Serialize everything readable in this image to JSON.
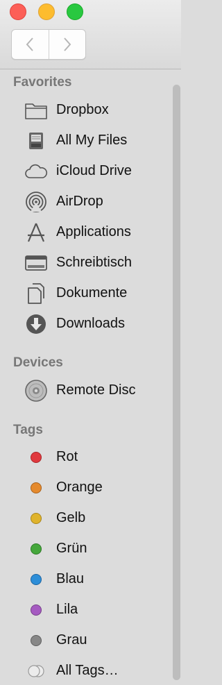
{
  "window": {
    "traffic_lights": {
      "close": "#fc5f57",
      "minimize": "#fdbc2e",
      "zoom": "#29c840"
    }
  },
  "nav": {
    "back_icon": "chevron-left-icon",
    "forward_icon": "chevron-right-icon"
  },
  "sidebar": {
    "favorites": {
      "header": "Favorites",
      "items": [
        {
          "label": "Dropbox",
          "icon": "folder-icon"
        },
        {
          "label": "All My Files",
          "icon": "all-files-icon"
        },
        {
          "label": "iCloud Drive",
          "icon": "cloud-icon"
        },
        {
          "label": "AirDrop",
          "icon": "airdrop-icon"
        },
        {
          "label": "Applications",
          "icon": "applications-icon"
        },
        {
          "label": "Schreibtisch",
          "icon": "desktop-icon"
        },
        {
          "label": "Dokumente",
          "icon": "document-icon"
        },
        {
          "label": "Downloads",
          "icon": "download-icon"
        }
      ]
    },
    "devices": {
      "header": "Devices",
      "items": [
        {
          "label": "Remote Disc",
          "icon": "disc-icon"
        }
      ]
    },
    "tags": {
      "header": "Tags",
      "items": [
        {
          "label": "Rot",
          "color": "#e0393e"
        },
        {
          "label": "Orange",
          "color": "#e58a2d"
        },
        {
          "label": "Gelb",
          "color": "#dfb32c"
        },
        {
          "label": "Grün",
          "color": "#45a73b"
        },
        {
          "label": "Blau",
          "color": "#2d8ed8"
        },
        {
          "label": "Lila",
          "color": "#a55ac1"
        },
        {
          "label": "Grau",
          "color": "#878787"
        },
        {
          "label": "All Tags…",
          "icon": "all-tags-icon"
        }
      ]
    }
  }
}
